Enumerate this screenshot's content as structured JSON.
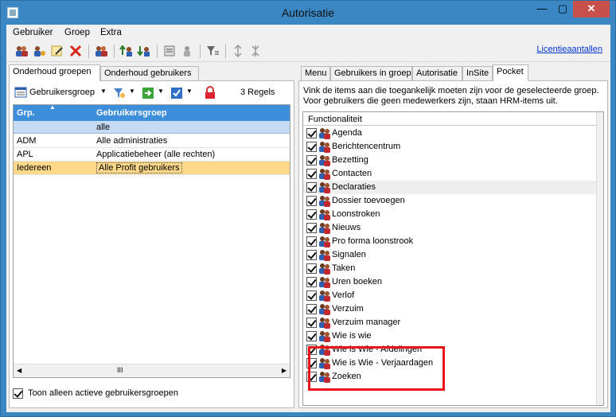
{
  "window": {
    "title": "Autorisatie",
    "min": "—",
    "max": "▢",
    "close": "✕"
  },
  "menu": [
    "Gebruiker",
    "Groep",
    "Extra"
  ],
  "toolbar": {
    "link": "Licentieaantallen"
  },
  "left": {
    "tabs": [
      "Onderhoud groepen",
      "Onderhoud gebruikers"
    ],
    "tool": {
      "groupby": "Gebruikersgroep",
      "count": "3 Regels"
    },
    "columns": [
      "Grp.",
      "Gebruikersgroep"
    ],
    "filter": "alle",
    "rows": [
      {
        "grp": "ADM",
        "name": "Alle administraties"
      },
      {
        "grp": "APL",
        "name": "Applicatiebeheer (alle rechten)"
      },
      {
        "grp": "Iedereen",
        "name": "Alle Profit gebruikers"
      }
    ],
    "scroll_mid": "III",
    "checkbox_label": "Toon alleen actieve gebruikersgroepen"
  },
  "right": {
    "tabs": [
      "Menu",
      "Gebruikers in groep",
      "Autorisatie",
      "InSite",
      "Pocket"
    ],
    "desc1": "Vink de items aan die toegankelijk moeten zijn voor de geselecteerde groep.",
    "desc2": "Voor gebruikers die geen medewerkers zijn, staan HRM-items uit.",
    "column": "Functionaliteit",
    "items": [
      "Agenda",
      "Berichtencentrum",
      "Bezetting",
      "Contacten",
      "Declaraties",
      "Dossier toevoegen",
      "Loonstroken",
      "Nieuws",
      "Pro forma loonstrook",
      "Signalen",
      "Taken",
      "Uren boeken",
      "Verlof",
      "Verzuim",
      "Verzuim manager",
      "Wie is wie",
      "Wie is Wie - Afdelingen",
      "Wie is Wie - Verjaardagen",
      "Zoeken"
    ]
  },
  "colors": {
    "accent": "#3a87c4",
    "header": "#3d8fdc",
    "selected": "#ffd88a",
    "highlight_box": "#e8141a"
  }
}
